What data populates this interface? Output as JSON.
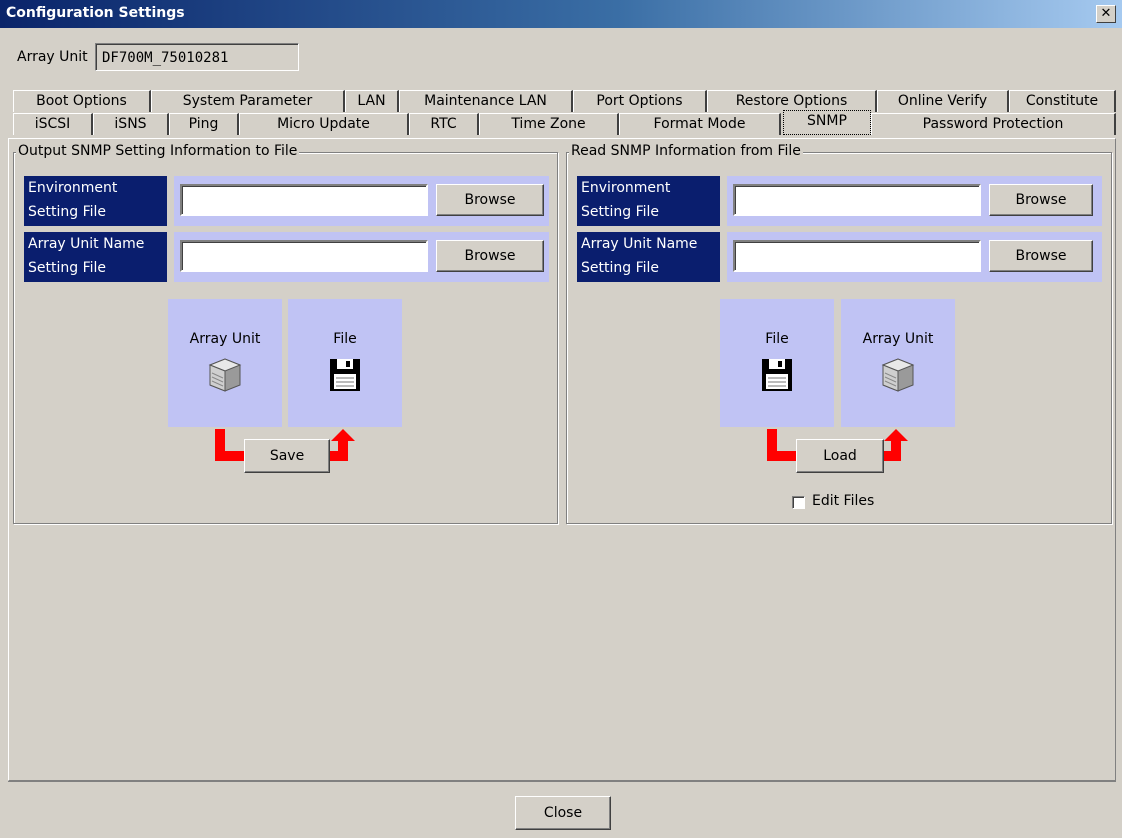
{
  "window": {
    "title": "Configuration Settings",
    "close_glyph": "✕"
  },
  "array_unit": {
    "label": "Array Unit",
    "value": "DF700M_75010281"
  },
  "tabs_row1": [
    "Boot Options",
    "System Parameter",
    "LAN",
    "Maintenance LAN",
    "Port Options",
    "Restore Options",
    "Online Verify",
    "Constitute"
  ],
  "tabs_row2": [
    "iSCSI",
    "iSNS",
    "Ping",
    "Micro Update",
    "RTC",
    "Time Zone",
    "Format Mode",
    "SNMP",
    "Password Protection"
  ],
  "selected_tab": "SNMP",
  "output_group": {
    "legend": "Output SNMP Setting Information to File",
    "env_label_1": "Environment",
    "env_label_2": "Setting File",
    "env_value": "",
    "env_browse": "Browse",
    "name_label_1": "Array Unit Name",
    "name_label_2": "Setting File",
    "name_value": "",
    "name_browse": "Browse",
    "tile_left": "Array Unit",
    "tile_right": "File",
    "action_button": "Save"
  },
  "read_group": {
    "legend": "Read SNMP Information from File",
    "env_label_1": "Environment",
    "env_label_2": "Setting File",
    "env_value": "",
    "env_browse": "Browse",
    "name_label_1": "Array Unit Name",
    "name_label_2": "Setting File",
    "name_value": "",
    "name_browse": "Browse",
    "tile_left": "File",
    "tile_right": "Array Unit",
    "action_button": "Load",
    "edit_files_label": "Edit Files",
    "edit_files_checked": false
  },
  "footer": {
    "close_label": "Close"
  },
  "icons": {
    "disk": "array-unit-disk-icon",
    "floppy": "floppy-disk-icon"
  },
  "colors": {
    "title_blue": "#0a246a",
    "label_bg": "#0a1e6e",
    "panel_lavender": "#c0c3f4",
    "arrow_red": "#ff0000"
  }
}
